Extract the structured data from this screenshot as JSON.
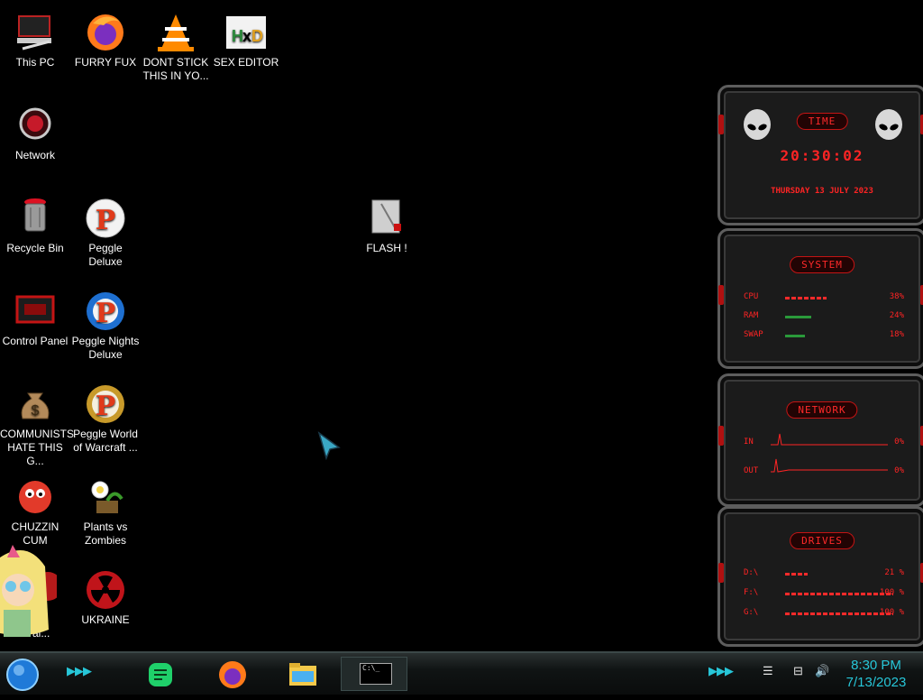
{
  "desktop": {
    "icons": [
      {
        "label": "This PC",
        "icon": "this-pc-icon"
      },
      {
        "label": "FURRY FUX",
        "icon": "firefox-icon"
      },
      {
        "label": "DONT STICK\nTHIS IN YO...",
        "icon": "vlc-icon"
      },
      {
        "label": "SEX EDITOR",
        "icon": "hxd-icon"
      },
      {
        "label": "Network",
        "icon": "network-icon"
      },
      {
        "label": "Recycle Bin",
        "icon": "recycle-bin-icon"
      },
      {
        "label": "Peggle Deluxe",
        "icon": "peggle-icon"
      },
      {
        "label": "FLASH !",
        "icon": "flash-icon"
      },
      {
        "label": "Control Panel",
        "icon": "control-panel-icon"
      },
      {
        "label": "Peggle Nights\nDeluxe",
        "icon": "peggle-nights-icon"
      },
      {
        "label": "COMMUNISTS\nHATE THIS G...",
        "icon": "money-bag-icon"
      },
      {
        "label": "Peggle World\nof Warcraft ...",
        "icon": "peggle-wow-icon"
      },
      {
        "label": "CHUZZIN\nCUM",
        "icon": "chuzzle-icon"
      },
      {
        "label": "Plants vs\nZombies",
        "icon": "pvz-icon"
      },
      {
        "label": "ad\nal...",
        "icon": "partially-hidden-icon"
      },
      {
        "label": "UKRAINE",
        "icon": "radiation-icon"
      }
    ]
  },
  "widgets": {
    "time": {
      "title": "TIME",
      "clock": "20:30:02",
      "date": "THURSDAY 13 JULY 2023"
    },
    "system": {
      "title": "SYSTEM",
      "rows": [
        {
          "label": "CPU",
          "value": "38%",
          "level": 0.38
        },
        {
          "label": "RAM",
          "value": "24%",
          "level": 0.24
        },
        {
          "label": "SWAP",
          "value": "18%",
          "level": 0.18
        }
      ]
    },
    "network": {
      "title": "NETWORK",
      "rows": [
        {
          "label": "IN",
          "value": "0%"
        },
        {
          "label": "OUT",
          "value": "0%"
        }
      ]
    },
    "drives": {
      "title": "DRIVES",
      "rows": [
        {
          "label": "D:\\",
          "value": "21 %",
          "level": 0.21
        },
        {
          "label": "F:\\",
          "value": "100 %",
          "level": 1.0
        },
        {
          "label": "G:\\",
          "value": "100 %",
          "level": 1.0
        }
      ]
    }
  },
  "taskbar": {
    "apps": [
      {
        "name": "notes-app",
        "icon": "notes-icon"
      },
      {
        "name": "firefox",
        "icon": "firefox-icon"
      },
      {
        "name": "file-explorer",
        "icon": "folder-icon"
      },
      {
        "name": "command-prompt",
        "icon": "terminal-icon",
        "text": "C:\\_"
      }
    ],
    "clock": {
      "time": "8:30 PM",
      "date": "7/13/2023"
    },
    "colors": {
      "accent": "#27c6d8",
      "widget_red": "#ff2424"
    }
  }
}
